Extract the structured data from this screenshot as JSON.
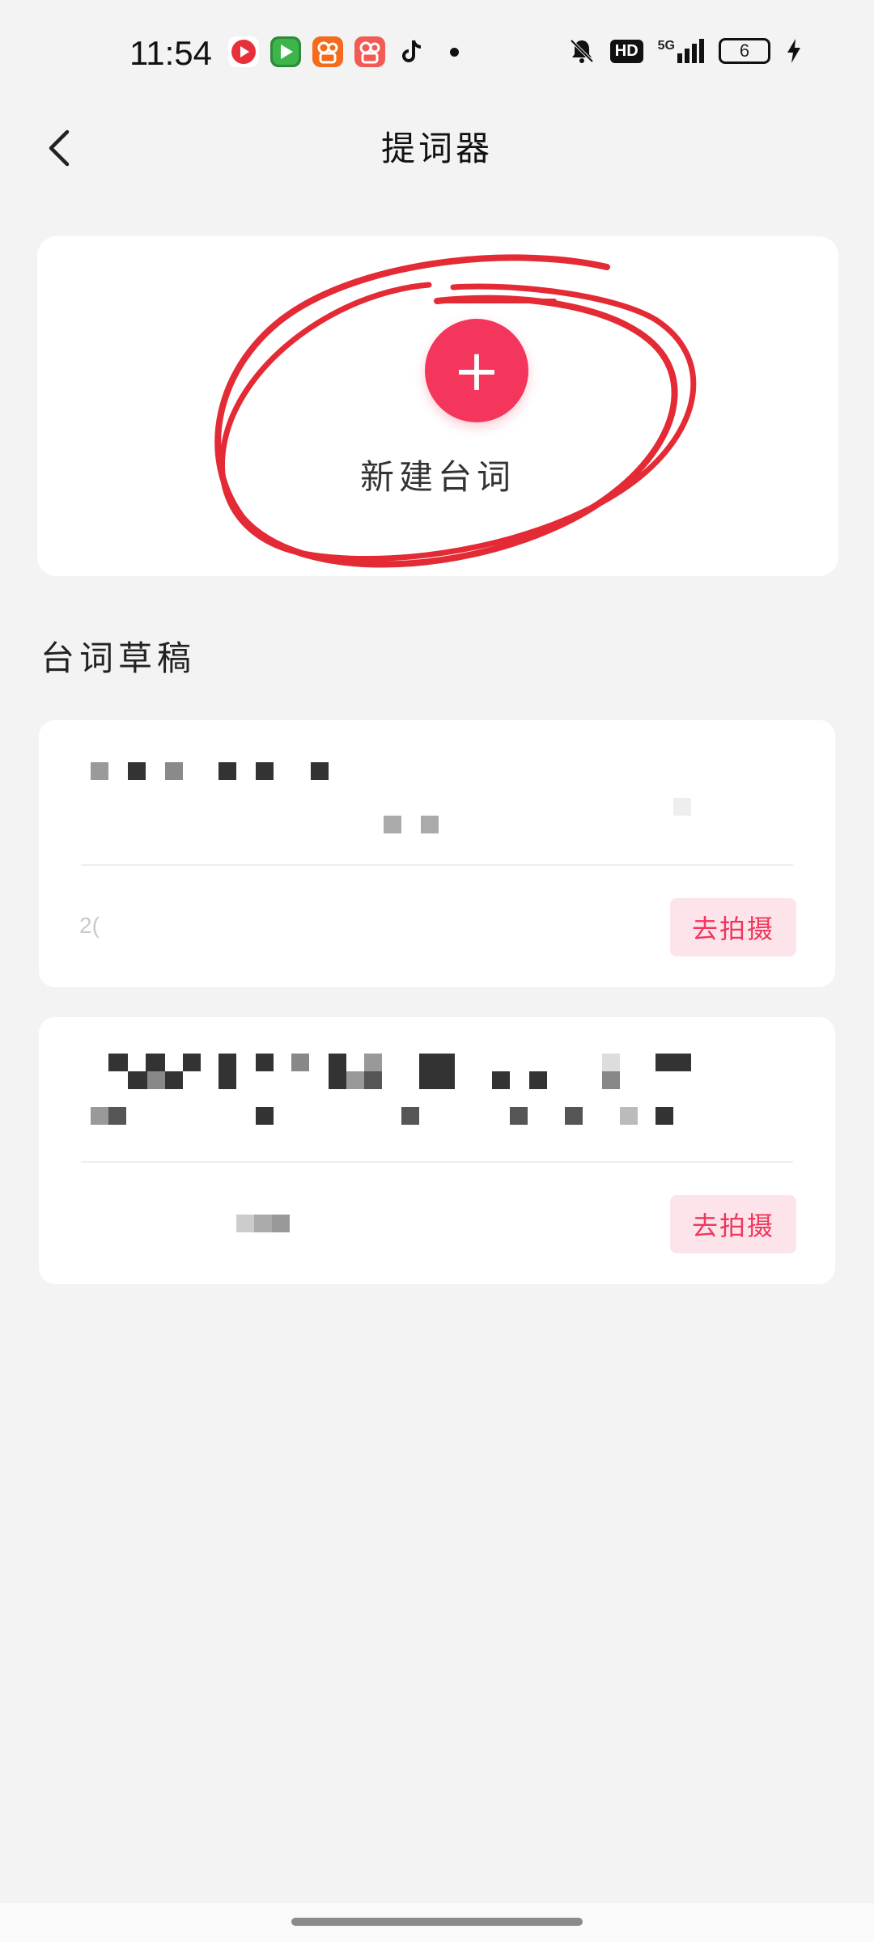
{
  "status_bar": {
    "time": "11:54",
    "network": "5G",
    "hd_label": "HD",
    "battery": "6"
  },
  "header": {
    "title": "提词器"
  },
  "new_script": {
    "plus_symbol": "+",
    "label": "新建台词"
  },
  "drafts": {
    "section_title": "台词草稿",
    "items": [
      {
        "date_text": "2(",
        "action": "去拍摄"
      },
      {
        "date_text": "",
        "action": "去拍摄"
      }
    ]
  },
  "colors": {
    "accent": "#f5365c",
    "annotation": "#e32a35",
    "shoot_bg": "#fde4ea"
  }
}
